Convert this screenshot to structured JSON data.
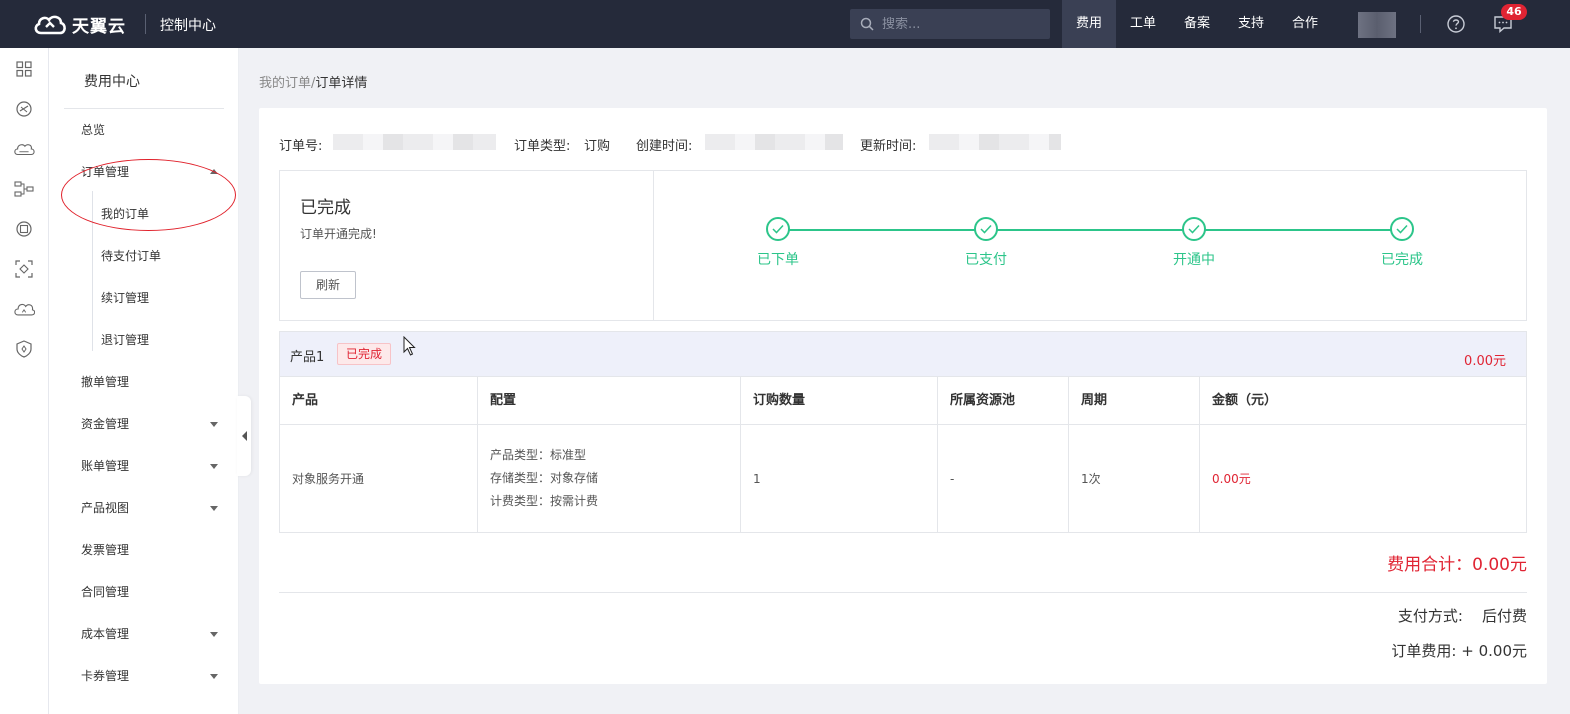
{
  "topbar": {
    "brand": "天翼云",
    "console_title": "控制中心",
    "search_placeholder": "搜索...",
    "nav": [
      "费用",
      "工单",
      "备案",
      "支持",
      "合作"
    ],
    "active_nav": "费用",
    "message_count": "46"
  },
  "rail_icons": [
    "dashboard-icon",
    "planet-icon",
    "cloud-server-icon",
    "network-icon",
    "database-icon",
    "scan-icon",
    "cloud-storage-icon",
    "shield-icon"
  ],
  "sidebar": {
    "title": "费用中心",
    "overview": "总览",
    "order_mgmt": "订单管理",
    "sub_items": [
      "我的订单",
      "待支付订单",
      "续订管理",
      "退订管理"
    ],
    "items": [
      "撤单管理",
      "资金管理",
      "账单管理",
      "产品视图",
      "发票管理",
      "合同管理",
      "成本管理",
      "卡券管理"
    ]
  },
  "breadcrumb": {
    "parent": "我的订单",
    "sep": "/",
    "current": "订单详情"
  },
  "order_meta": {
    "order_no_label": "订单号:",
    "type_label": "订单类型:",
    "type_value": "订购",
    "created_label": "创建时间:",
    "updated_label": "更新时间:"
  },
  "status": {
    "title": "已完成",
    "desc": "订单开通完成!",
    "refresh": "刷新",
    "steps": [
      "已下单",
      "已支付",
      "开通中",
      "已完成"
    ]
  },
  "product": {
    "name": "产品1",
    "badge": "已完成",
    "amount": "0.00元"
  },
  "table": {
    "headers": [
      "产品",
      "配置",
      "订购数量",
      "所属资源池",
      "周期",
      "金额（元）"
    ],
    "row": {
      "product": "对象服务开通",
      "config": [
        "产品类型：标准型",
        "存储类型：对象存储",
        "计费类型：按需计费"
      ],
      "quantity": "1",
      "pool": "-",
      "period": "1次",
      "amount": "0.00元"
    }
  },
  "summary": {
    "total": "费用合计：0.00元",
    "pay_method_label": "支付方式:",
    "pay_method_value": "后付费",
    "order_fee_label": "订单费用:",
    "order_fee_value": "+ 0.00元"
  },
  "colors": {
    "topbar": "#252a3a",
    "success": "#2cc58a",
    "danger": "#e02433",
    "product_head_bg": "#eef0fa"
  }
}
